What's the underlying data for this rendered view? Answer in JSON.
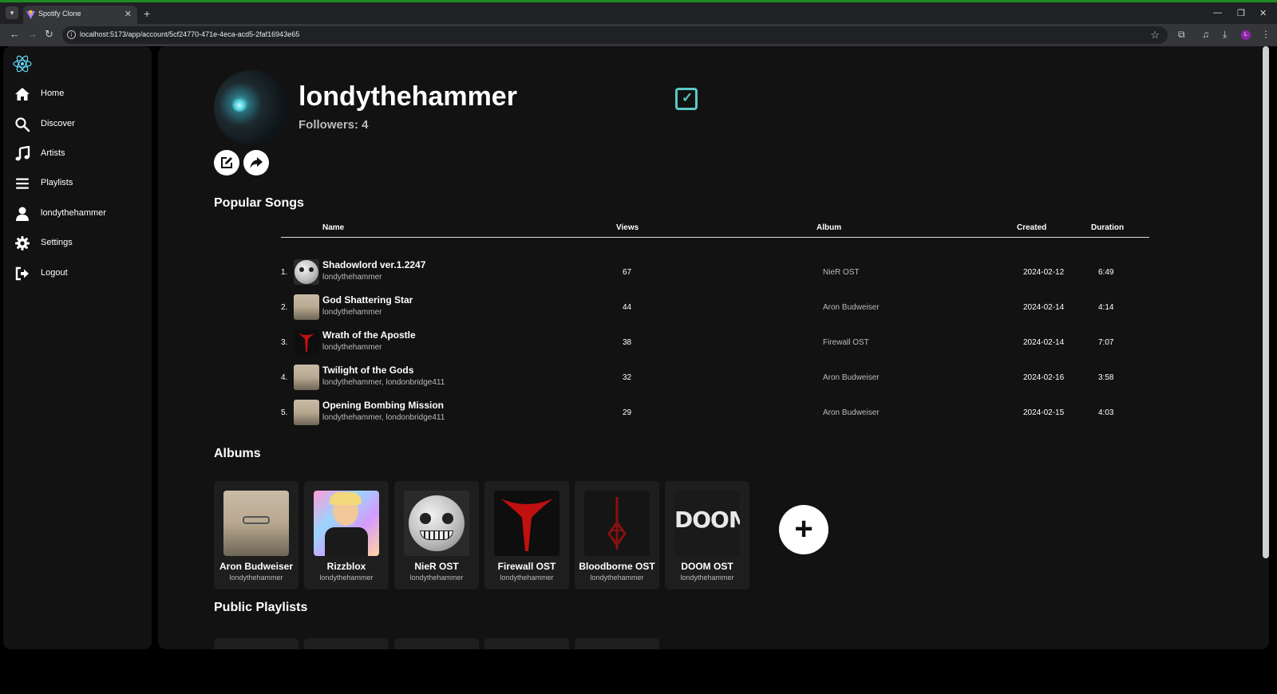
{
  "browser": {
    "tab_title": "Spotify Clone",
    "url": "localhost:5173/app/account/5cf24770-471e-4eca-acd5-2faf16943e65",
    "profile_initial": "L"
  },
  "sidebar": {
    "items": [
      {
        "label": "Home",
        "icon": "home-icon"
      },
      {
        "label": "Discover",
        "icon": "search-icon"
      },
      {
        "label": "Artists",
        "icon": "music-note-icon"
      },
      {
        "label": "Playlists",
        "icon": "list-icon"
      },
      {
        "label": "londythehammer",
        "icon": "user-icon"
      },
      {
        "label": "Settings",
        "icon": "gear-icon"
      },
      {
        "label": "Logout",
        "icon": "logout-icon"
      }
    ]
  },
  "profile": {
    "username": "londythehammer",
    "followers": "Followers: 4",
    "verified": true
  },
  "popular_songs": {
    "title": "Popular Songs",
    "columns": {
      "name": "Name",
      "views": "Views",
      "album": "Album",
      "created": "Created",
      "duration": "Duration"
    },
    "rows": [
      {
        "num": "1.",
        "title": "Shadowlord ver.1.2247",
        "artists": "londythehammer",
        "views": "67",
        "album": "NieR OST",
        "created": "2024-02-12",
        "duration": "6:49",
        "art": "moon"
      },
      {
        "num": "2.",
        "title": "God Shattering Star",
        "artists": "londythehammer",
        "views": "44",
        "album": "Aron Budweiser",
        "created": "2024-02-14",
        "duration": "4:14",
        "art": "face"
      },
      {
        "num": "3.",
        "title": "Wrath of the Apostle",
        "artists": "londythehammer",
        "views": "38",
        "album": "Firewall OST",
        "created": "2024-02-14",
        "duration": "7:07",
        "art": "firewall"
      },
      {
        "num": "4.",
        "title": "Twilight of the Gods",
        "artists": "londythehammer, londonbridge411",
        "views": "32",
        "album": "Aron Budweiser",
        "created": "2024-02-16",
        "duration": "3:58",
        "art": "face"
      },
      {
        "num": "5.",
        "title": "Opening Bombing Mission",
        "artists": "londythehammer, londonbridge411",
        "views": "29",
        "album": "Aron Budweiser",
        "created": "2024-02-15",
        "duration": "4:03",
        "art": "face"
      }
    ]
  },
  "albums": {
    "title": "Albums",
    "items": [
      {
        "title": "Aron Budweiser",
        "owner": "londythehammer",
        "art": "face"
      },
      {
        "title": "Rizzblox",
        "owner": "londythehammer",
        "art": "rizz"
      },
      {
        "title": "NieR OST",
        "owner": "londythehammer",
        "art": "moon"
      },
      {
        "title": "Firewall OST",
        "owner": "londythehammer",
        "art": "firewall"
      },
      {
        "title": "Bloodborne OST",
        "owner": "londythehammer",
        "art": "bloodborne"
      },
      {
        "title": "DOOM OST",
        "owner": "londythehammer",
        "art": "doom"
      }
    ],
    "doom_logo_text": "DOOM"
  },
  "public_playlists": {
    "title": "Public Playlists"
  },
  "colors": {
    "accent": "#5cc9c4",
    "background": "#121212",
    "card": "#1e1e1e",
    "react_logo": "#61dafb"
  }
}
